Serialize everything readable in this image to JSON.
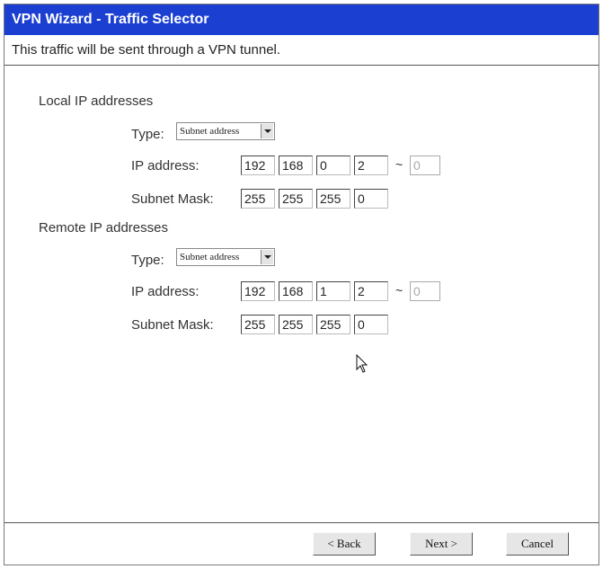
{
  "window": {
    "title": "VPN Wizard - Traffic Selector",
    "description": "This traffic will be sent through a VPN tunnel."
  },
  "local": {
    "heading": "Local IP addresses",
    "type_label": "Type:",
    "type_value": "Subnet address",
    "ip_label": "IP address:",
    "ip": [
      "192",
      "168",
      "0",
      "2"
    ],
    "ip_range_sep": "~",
    "ip_range_end": "0",
    "mask_label": "Subnet Mask:",
    "mask": [
      "255",
      "255",
      "255",
      "0"
    ]
  },
  "remote": {
    "heading": "Remote IP addresses",
    "type_label": "Type:",
    "type_value": "Subnet address",
    "ip_label": "IP address:",
    "ip": [
      "192",
      "168",
      "1",
      "2"
    ],
    "ip_range_sep": "~",
    "ip_range_end": "0",
    "mask_label": "Subnet Mask:",
    "mask": [
      "255",
      "255",
      "255",
      "0"
    ]
  },
  "buttons": {
    "back": "< Back",
    "next": "Next >",
    "cancel": "Cancel"
  },
  "colors": {
    "titlebar": "#1a3fd1",
    "titlebar_text": "#ffffff"
  }
}
